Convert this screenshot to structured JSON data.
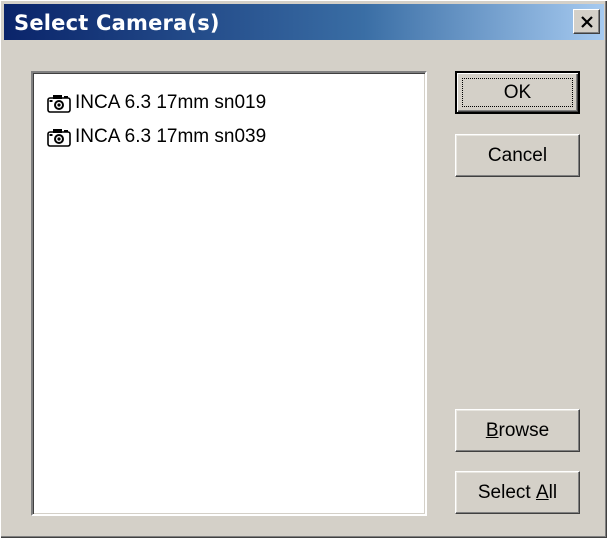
{
  "window": {
    "title": "Select Camera(s)",
    "close_glyph": "×"
  },
  "cameras": [
    {
      "label": "INCA 6.3 17mm sn019",
      "icon": "camera-icon"
    },
    {
      "label": "INCA 6.3 17mm sn039",
      "icon": "camera-icon"
    }
  ],
  "buttons": {
    "ok": "OK",
    "cancel": "Cancel",
    "browse_mnemonic": "B",
    "browse_rest": "rowse",
    "selectall_pre": "Select ",
    "selectall_mnemonic": "A",
    "selectall_rest": "ll"
  },
  "colors": {
    "title_gradient_start": "#0a246a",
    "title_gradient_end": "#a6caf0",
    "face": "#d4d0c8"
  }
}
